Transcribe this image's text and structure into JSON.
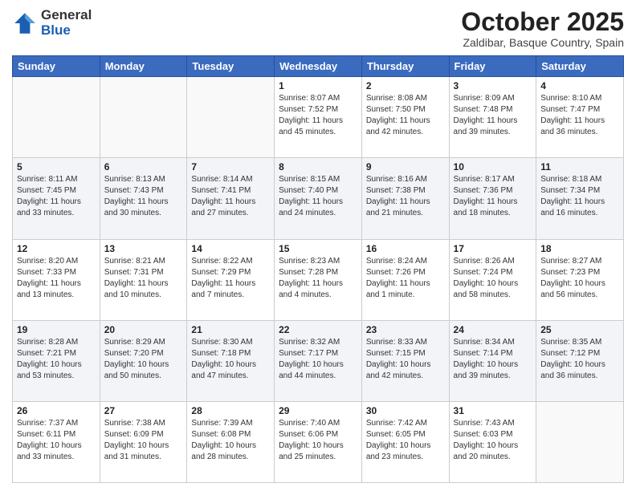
{
  "header": {
    "logo_general": "General",
    "logo_blue": "Blue",
    "month": "October 2025",
    "location": "Zaldibar, Basque Country, Spain"
  },
  "calendar": {
    "days_of_week": [
      "Sunday",
      "Monday",
      "Tuesday",
      "Wednesday",
      "Thursday",
      "Friday",
      "Saturday"
    ],
    "weeks": [
      [
        {
          "day": "",
          "info": ""
        },
        {
          "day": "",
          "info": ""
        },
        {
          "day": "",
          "info": ""
        },
        {
          "day": "1",
          "info": "Sunrise: 8:07 AM\nSunset: 7:52 PM\nDaylight: 11 hours and 45 minutes."
        },
        {
          "day": "2",
          "info": "Sunrise: 8:08 AM\nSunset: 7:50 PM\nDaylight: 11 hours and 42 minutes."
        },
        {
          "day": "3",
          "info": "Sunrise: 8:09 AM\nSunset: 7:48 PM\nDaylight: 11 hours and 39 minutes."
        },
        {
          "day": "4",
          "info": "Sunrise: 8:10 AM\nSunset: 7:47 PM\nDaylight: 11 hours and 36 minutes."
        }
      ],
      [
        {
          "day": "5",
          "info": "Sunrise: 8:11 AM\nSunset: 7:45 PM\nDaylight: 11 hours and 33 minutes."
        },
        {
          "day": "6",
          "info": "Sunrise: 8:13 AM\nSunset: 7:43 PM\nDaylight: 11 hours and 30 minutes."
        },
        {
          "day": "7",
          "info": "Sunrise: 8:14 AM\nSunset: 7:41 PM\nDaylight: 11 hours and 27 minutes."
        },
        {
          "day": "8",
          "info": "Sunrise: 8:15 AM\nSunset: 7:40 PM\nDaylight: 11 hours and 24 minutes."
        },
        {
          "day": "9",
          "info": "Sunrise: 8:16 AM\nSunset: 7:38 PM\nDaylight: 11 hours and 21 minutes."
        },
        {
          "day": "10",
          "info": "Sunrise: 8:17 AM\nSunset: 7:36 PM\nDaylight: 11 hours and 18 minutes."
        },
        {
          "day": "11",
          "info": "Sunrise: 8:18 AM\nSunset: 7:34 PM\nDaylight: 11 hours and 16 minutes."
        }
      ],
      [
        {
          "day": "12",
          "info": "Sunrise: 8:20 AM\nSunset: 7:33 PM\nDaylight: 11 hours and 13 minutes."
        },
        {
          "day": "13",
          "info": "Sunrise: 8:21 AM\nSunset: 7:31 PM\nDaylight: 11 hours and 10 minutes."
        },
        {
          "day": "14",
          "info": "Sunrise: 8:22 AM\nSunset: 7:29 PM\nDaylight: 11 hours and 7 minutes."
        },
        {
          "day": "15",
          "info": "Sunrise: 8:23 AM\nSunset: 7:28 PM\nDaylight: 11 hours and 4 minutes."
        },
        {
          "day": "16",
          "info": "Sunrise: 8:24 AM\nSunset: 7:26 PM\nDaylight: 11 hours and 1 minute."
        },
        {
          "day": "17",
          "info": "Sunrise: 8:26 AM\nSunset: 7:24 PM\nDaylight: 10 hours and 58 minutes."
        },
        {
          "day": "18",
          "info": "Sunrise: 8:27 AM\nSunset: 7:23 PM\nDaylight: 10 hours and 56 minutes."
        }
      ],
      [
        {
          "day": "19",
          "info": "Sunrise: 8:28 AM\nSunset: 7:21 PM\nDaylight: 10 hours and 53 minutes."
        },
        {
          "day": "20",
          "info": "Sunrise: 8:29 AM\nSunset: 7:20 PM\nDaylight: 10 hours and 50 minutes."
        },
        {
          "day": "21",
          "info": "Sunrise: 8:30 AM\nSunset: 7:18 PM\nDaylight: 10 hours and 47 minutes."
        },
        {
          "day": "22",
          "info": "Sunrise: 8:32 AM\nSunset: 7:17 PM\nDaylight: 10 hours and 44 minutes."
        },
        {
          "day": "23",
          "info": "Sunrise: 8:33 AM\nSunset: 7:15 PM\nDaylight: 10 hours and 42 minutes."
        },
        {
          "day": "24",
          "info": "Sunrise: 8:34 AM\nSunset: 7:14 PM\nDaylight: 10 hours and 39 minutes."
        },
        {
          "day": "25",
          "info": "Sunrise: 8:35 AM\nSunset: 7:12 PM\nDaylight: 10 hours and 36 minutes."
        }
      ],
      [
        {
          "day": "26",
          "info": "Sunrise: 7:37 AM\nSunset: 6:11 PM\nDaylight: 10 hours and 33 minutes."
        },
        {
          "day": "27",
          "info": "Sunrise: 7:38 AM\nSunset: 6:09 PM\nDaylight: 10 hours and 31 minutes."
        },
        {
          "day": "28",
          "info": "Sunrise: 7:39 AM\nSunset: 6:08 PM\nDaylight: 10 hours and 28 minutes."
        },
        {
          "day": "29",
          "info": "Sunrise: 7:40 AM\nSunset: 6:06 PM\nDaylight: 10 hours and 25 minutes."
        },
        {
          "day": "30",
          "info": "Sunrise: 7:42 AM\nSunset: 6:05 PM\nDaylight: 10 hours and 23 minutes."
        },
        {
          "day": "31",
          "info": "Sunrise: 7:43 AM\nSunset: 6:03 PM\nDaylight: 10 hours and 20 minutes."
        },
        {
          "day": "",
          "info": ""
        }
      ]
    ]
  }
}
